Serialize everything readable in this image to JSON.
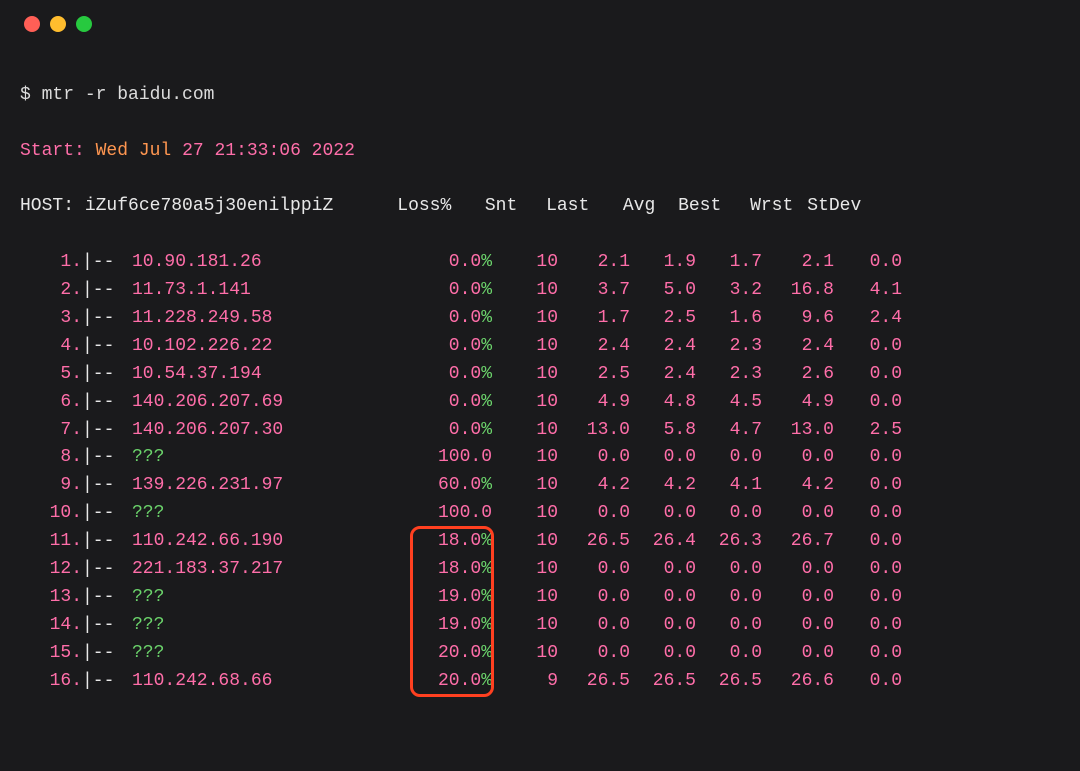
{
  "window": {
    "buttons": [
      "close",
      "minimize",
      "zoom"
    ]
  },
  "prompt": "$ ",
  "command": "mtr -r baidu.com",
  "start_label": "Start:",
  "start_time_parts": {
    "weekday": "Wed Jul",
    "tail": "27 21:33:06 2022"
  },
  "host_label": "HOST:",
  "hostname": "iZuf6ce780a5j30enilppiZ",
  "headers": {
    "loss": "Loss%",
    "snt": "Snt",
    "last": "Last",
    "avg": "Avg",
    "best": "Best",
    "wrst": "Wrst",
    "stdev": "StDev"
  },
  "sep": "|--",
  "hops": [
    {
      "n": "1.",
      "host": "10.90.181.26",
      "loss": "0.0",
      "pct": true,
      "snt": "10",
      "last": "2.1",
      "avg": "1.9",
      "best": "1.7",
      "wrst": "2.1",
      "stdev": "0.0"
    },
    {
      "n": "2.",
      "host": "11.73.1.141",
      "loss": "0.0",
      "pct": true,
      "snt": "10",
      "last": "3.7",
      "avg": "5.0",
      "best": "3.2",
      "wrst": "16.8",
      "stdev": "4.1"
    },
    {
      "n": "3.",
      "host": "11.228.249.58",
      "loss": "0.0",
      "pct": true,
      "snt": "10",
      "last": "1.7",
      "avg": "2.5",
      "best": "1.6",
      "wrst": "9.6",
      "stdev": "2.4"
    },
    {
      "n": "4.",
      "host": "10.102.226.22",
      "loss": "0.0",
      "pct": true,
      "snt": "10",
      "last": "2.4",
      "avg": "2.4",
      "best": "2.3",
      "wrst": "2.4",
      "stdev": "0.0"
    },
    {
      "n": "5.",
      "host": "10.54.37.194",
      "loss": "0.0",
      "pct": true,
      "snt": "10",
      "last": "2.5",
      "avg": "2.4",
      "best": "2.3",
      "wrst": "2.6",
      "stdev": "0.0"
    },
    {
      "n": "6.",
      "host": "140.206.207.69",
      "loss": "0.0",
      "pct": true,
      "snt": "10",
      "last": "4.9",
      "avg": "4.8",
      "best": "4.5",
      "wrst": "4.9",
      "stdev": "0.0"
    },
    {
      "n": "7.",
      "host": "140.206.207.30",
      "loss": "0.0",
      "pct": true,
      "snt": "10",
      "last": "13.0",
      "avg": "5.8",
      "best": "4.7",
      "wrst": "13.0",
      "stdev": "2.5"
    },
    {
      "n": "8.",
      "host": "???",
      "loss": "100.0",
      "pct": false,
      "snt": "10",
      "last": "0.0",
      "avg": "0.0",
      "best": "0.0",
      "wrst": "0.0",
      "stdev": "0.0",
      "unknown": true
    },
    {
      "n": "9.",
      "host": "139.226.231.97",
      "loss": "60.0",
      "pct": true,
      "snt": "10",
      "last": "4.2",
      "avg": "4.2",
      "best": "4.1",
      "wrst": "4.2",
      "stdev": "0.0"
    },
    {
      "n": "10.",
      "host": "???",
      "loss": "100.0",
      "pct": false,
      "snt": "10",
      "last": "0.0",
      "avg": "0.0",
      "best": "0.0",
      "wrst": "0.0",
      "stdev": "0.0",
      "unknown": true
    },
    {
      "n": "11.",
      "host": "110.242.66.190",
      "loss": "18.0",
      "pct": true,
      "snt": "10",
      "last": "26.5",
      "avg": "26.4",
      "best": "26.3",
      "wrst": "26.7",
      "stdev": "0.0"
    },
    {
      "n": "12.",
      "host": "221.183.37.217",
      "loss": "18.0",
      "pct": true,
      "snt": "10",
      "last": "0.0",
      "avg": "0.0",
      "best": "0.0",
      "wrst": "0.0",
      "stdev": "0.0"
    },
    {
      "n": "13.",
      "host": "???",
      "loss": "19.0",
      "pct": true,
      "snt": "10",
      "last": "0.0",
      "avg": "0.0",
      "best": "0.0",
      "wrst": "0.0",
      "stdev": "0.0",
      "unknown": true
    },
    {
      "n": "14.",
      "host": "???",
      "loss": "19.0",
      "pct": true,
      "snt": "10",
      "last": "0.0",
      "avg": "0.0",
      "best": "0.0",
      "wrst": "0.0",
      "stdev": "0.0",
      "unknown": true
    },
    {
      "n": "15.",
      "host": "???",
      "loss": "20.0",
      "pct": true,
      "snt": "10",
      "last": "0.0",
      "avg": "0.0",
      "best": "0.0",
      "wrst": "0.0",
      "stdev": "0.0",
      "unknown": true
    },
    {
      "n": "16.",
      "host": "110.242.68.66",
      "loss": "20.0",
      "pct": true,
      "snt": "9",
      "last": "26.5",
      "avg": "26.5",
      "best": "26.5",
      "wrst": "26.6",
      "stdev": "0.0"
    }
  ],
  "highlight": {
    "from_hop": 11,
    "to_hop": 16,
    "column": "loss"
  }
}
